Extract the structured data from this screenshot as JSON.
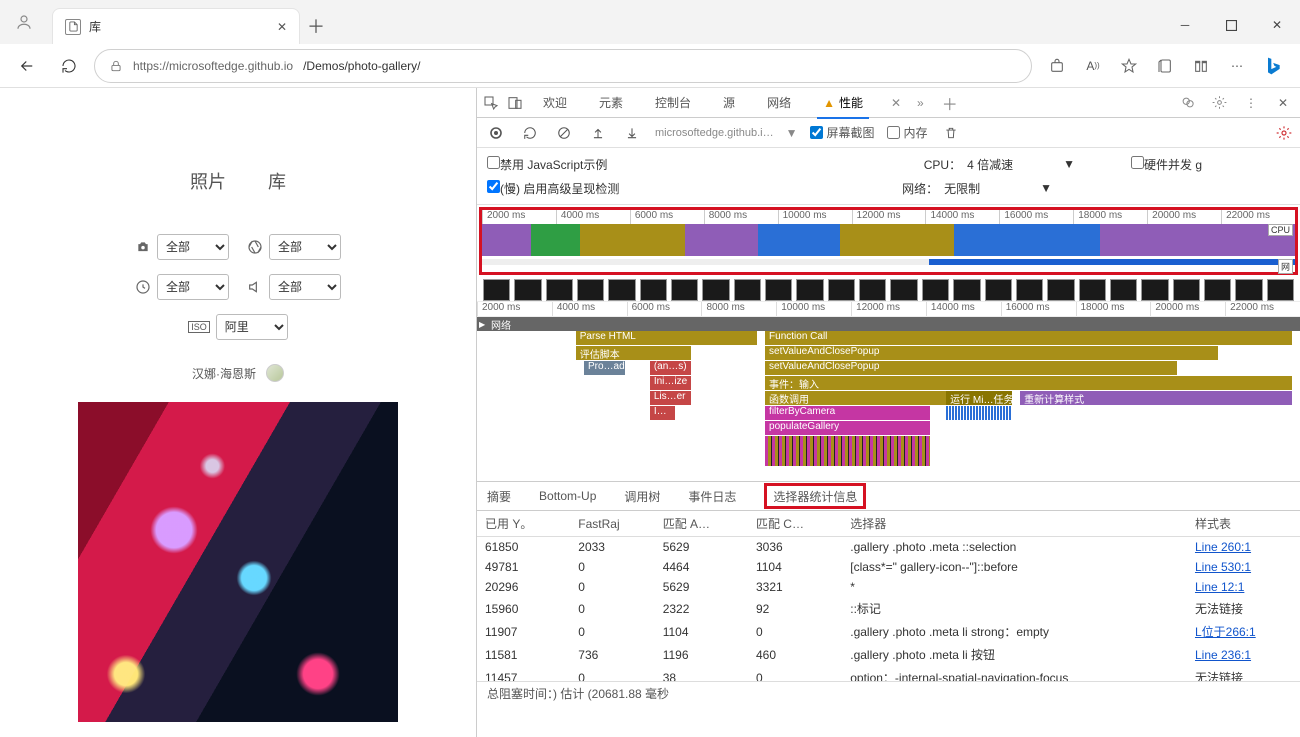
{
  "browser": {
    "tab_title": "库",
    "url_host": "https://microsoftedge.github.io",
    "url_path": "/Demos/photo-gallery/"
  },
  "page": {
    "tab_photos": "照片",
    "tab_library": "库",
    "filter_all": "全部",
    "filter_iso_label": "ISO",
    "filter_iso_value": "阿里",
    "author": "汉娜·海恩斯"
  },
  "devtools": {
    "tabs": {
      "welcome": "欢迎",
      "elements": "元素",
      "console": "控制台",
      "sources": "源",
      "network": "网络",
      "performance": "性能"
    },
    "toolbar": {
      "url": "microsoftedge.github.i…",
      "screenshots": "屏幕截图",
      "memory": "内存"
    },
    "opts": {
      "disable_js": "禁用 JavaScript示例",
      "cpu_label": "CPU：",
      "cpu_value": "4 倍减速",
      "hw_concurrency": "硬件并发 g",
      "slow_paint": "(慢)  启用高级呈现检测",
      "net_label": "网络：",
      "net_value": "无限制"
    },
    "overview": {
      "ticks": [
        "2000 ms",
        "4000 ms",
        "6000 ms",
        "8000 ms",
        "10000 ms",
        "12000 ms",
        "14000 ms",
        "16000 ms",
        "18000 ms",
        "20000 ms",
        "22000 ms"
      ],
      "cpu_label": "CPU",
      "net_label": "网"
    },
    "netrow": "网络",
    "flame": {
      "eval": "评估脚本",
      "proad": "Pro…ad",
      "ans": "(an…s)",
      "inize": "Ini…ize",
      "liser": "Lis…er",
      "l": "I…",
      "funcall": "Function Call",
      "setval1": "setValueAndClosePopup",
      "setval2": "setValueAndClosePopup",
      "event_input": "事件：输入",
      "func_call2": "函数调用",
      "run_task": "运行 Mi…任务",
      "recalc": "重新计算样式",
      "filterByCamera": "filterByCamera",
      "populateGallery": "populateGallery"
    },
    "detail_tabs": {
      "summary": "摘要",
      "bottomup": "Bottom-Up",
      "calltree": "调用树",
      "eventlog": "事件日志",
      "selector_stats": "选择器统计信息"
    },
    "table": {
      "headers": {
        "elapsed": "已用 Y。",
        "fastraj": "FastRaj",
        "matcha": "匹配 A…",
        "matchc": "匹配 C…",
        "selector": "选择器",
        "stylesheet": "样式表"
      },
      "rows": [
        {
          "elapsed": "61850",
          "fast": "2033",
          "ma": "5629",
          "mc": "3036",
          "sel": ".gallery .photo .meta ::selection",
          "ss": "Line 260:1",
          "link": true
        },
        {
          "elapsed": "49781",
          "fast": "0",
          "ma": "4464",
          "mc": "1104",
          "sel": "[class*=\" gallery-icon--\"]::before",
          "ss": "Line 530:1",
          "link": true
        },
        {
          "elapsed": "20296",
          "fast": "0",
          "ma": "5629",
          "mc": "3321",
          "sel": "*",
          "ss": "Line 12:1",
          "link": true
        },
        {
          "elapsed": "15960",
          "fast": "0",
          "ma": "2322",
          "mc": "92",
          "sel": "::标记",
          "ss": "无法链接",
          "link": false
        },
        {
          "elapsed": "11907",
          "fast": "0",
          "ma": "1104",
          "mc": "0",
          "sel": ".gallery .photo .meta li strong：empty",
          "ss": "L位于266:1",
          "link": true
        },
        {
          "elapsed": "11581",
          "fast": "736",
          "ma": "1196",
          "mc": "460",
          "sel": ".gallery .photo .meta li 按钮",
          "ss": "Line 236:1",
          "link": true
        },
        {
          "elapsed": "11457",
          "fast": "0",
          "ma": "38",
          "mc": "0",
          "sel": "option：-internal-spatial-navigation-focus",
          "ss": "无法链接",
          "link": false
        }
      ]
    },
    "footer": "总阻塞时间：) 估计 (20681.88 毫秒"
  }
}
